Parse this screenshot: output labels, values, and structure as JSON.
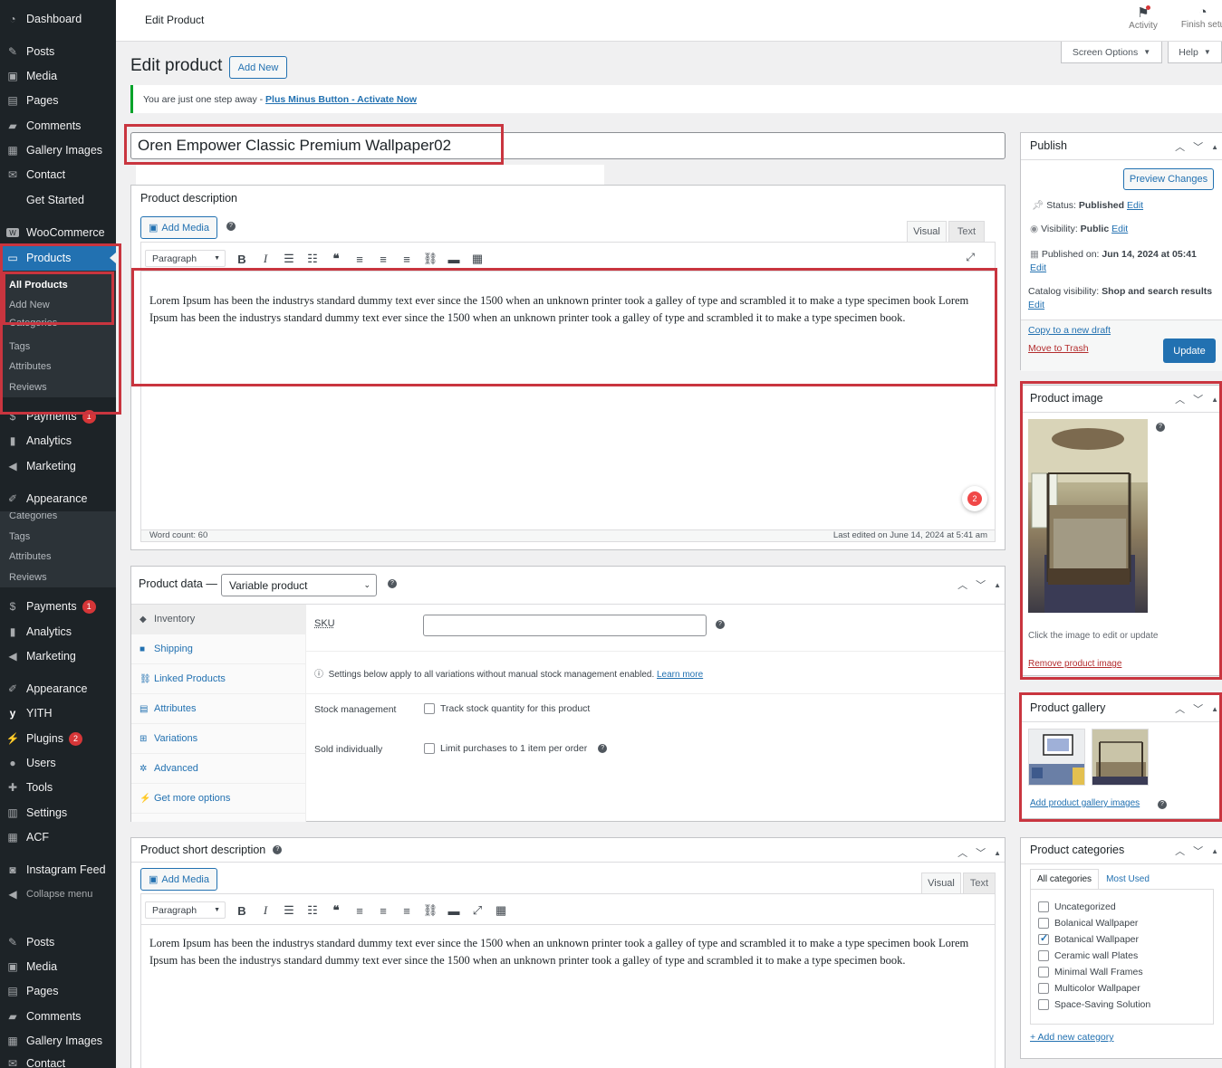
{
  "topbar": {
    "title": "Edit Product",
    "activity": "Activity",
    "finish_setup": "Finish setu"
  },
  "screen_options": "Screen Options",
  "help": "Help",
  "page": {
    "heading": "Edit product",
    "add_new": "Add New"
  },
  "notice": {
    "text": "You are just one step away - ",
    "link": "Plus Minus Button - Activate Now"
  },
  "product_title": "Oren Empower Classic Premium Wallpaper02",
  "sidebar": {
    "items": [
      "Dashboard",
      "Posts",
      "Media",
      "Pages",
      "Comments",
      "Gallery Images",
      "Contact",
      "Get Started",
      "WooCommerce",
      "Products"
    ],
    "products_sub": [
      "All Products",
      "Add New",
      "Categories",
      "Tags",
      "Attributes",
      "Reviews"
    ],
    "after_products": [
      "Payments",
      "Analytics",
      "Marketing",
      "Appearance"
    ],
    "payments_badge": "1",
    "sub2": [
      "Categories",
      "Tags",
      "Attributes",
      "Reviews"
    ],
    "lower": [
      "Payments",
      "Analytics",
      "Marketing",
      "Appearance",
      "YITH",
      "Plugins",
      "Users",
      "Tools",
      "Settings",
      "ACF",
      "Instagram Feed",
      "Collapse menu"
    ],
    "plugins_badge": "2",
    "bottom": [
      "Posts",
      "Media",
      "Pages",
      "Comments",
      "Gallery Images",
      "Contact"
    ]
  },
  "description": {
    "title": "Product description",
    "add_media": "Add Media",
    "visual": "Visual",
    "text": "Text",
    "format": "Paragraph",
    "body": "Lorem Ipsum has been the industrys standard dummy text ever since the 1500 when an unknown printer took a galley of type and scrambled it to make a type specimen book Lorem Ipsum has been the industrys standard dummy text ever since the 1500 when an unknown printer took a galley of type and scrambled it to make a type specimen book.",
    "word_count": "Word count: 60",
    "last_edited": "Last edited on June 14, 2024 at 5:41 am",
    "grammar_badge": "2"
  },
  "product_data": {
    "title": "Product data —",
    "type": "Variable product",
    "tabs": [
      "Inventory",
      "Shipping",
      "Linked Products",
      "Attributes",
      "Variations",
      "Advanced",
      "Get more options"
    ],
    "sku_label": "SKU",
    "settings_note": "Settings below apply to all variations without manual stock management enabled.",
    "learn_more": "Learn more",
    "stock_label": "Stock management",
    "stock_cb": "Track stock quantity for this product",
    "sold_label": "Sold individually",
    "sold_cb": "Limit purchases to 1 item per order"
  },
  "short_description": {
    "title": "Product short description",
    "add_media": "Add Media",
    "visual": "Visual",
    "text": "Text",
    "format": "Paragraph",
    "body": "Lorem Ipsum has been the industrys standard dummy text ever since the 1500 when an unknown printer took a galley of type and scrambled it to make a type specimen book Lorem Ipsum has been the industrys standard dummy text ever since the 1500 when an unknown printer took a galley of type and scrambled it to make a type specimen book."
  },
  "publish": {
    "title": "Publish",
    "preview": "Preview Changes",
    "status_label": "Status:",
    "status": "Published",
    "edit": "Edit",
    "visibility_label": "Visibility:",
    "visibility": "Public",
    "published_on_label": "Published on:",
    "published_on": "Jun 14, 2024 at 05:41",
    "catalog_label": "Catalog visibility:",
    "catalog": "Shop and search results",
    "copy": "Copy to a new draft",
    "trash": "Move to Trash",
    "update": "Update"
  },
  "product_image": {
    "title": "Product image",
    "hint": "Click the image to edit or update",
    "remove": "Remove product image"
  },
  "product_gallery": {
    "title": "Product gallery",
    "add": "Add product gallery images"
  },
  "categories": {
    "title": "Product categories",
    "tab_all": "All categories",
    "tab_most": "Most Used",
    "items": [
      {
        "name": "Uncategorized",
        "checked": false
      },
      {
        "name": "Bolanical Wallpaper",
        "checked": false
      },
      {
        "name": "Botanical Wallpaper",
        "checked": true
      },
      {
        "name": "Ceramic wall Plates",
        "checked": false
      },
      {
        "name": "Minimal Wall Frames",
        "checked": false
      },
      {
        "name": "Multicolor Wallpaper",
        "checked": false
      },
      {
        "name": "Space-Saving Solution",
        "checked": false
      }
    ],
    "add_new": "+ Add new category"
  }
}
